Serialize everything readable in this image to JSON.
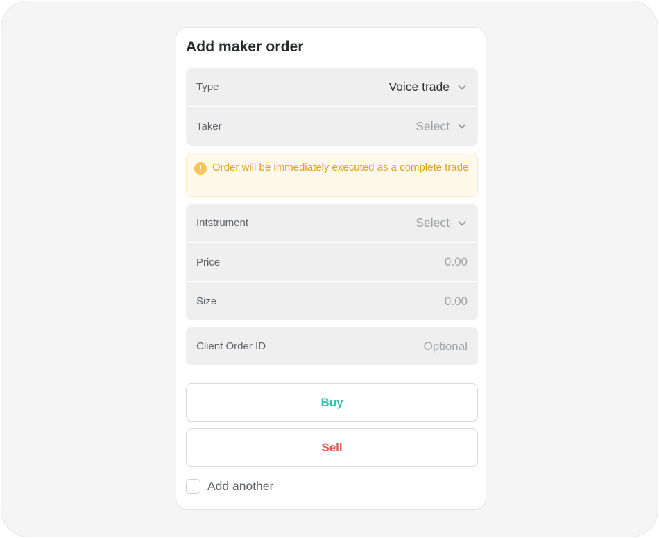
{
  "form": {
    "title": "Add maker order",
    "type": {
      "label": "Type",
      "value": "Voice trade"
    },
    "taker": {
      "label": "Taker",
      "value": "Select"
    },
    "notice": {
      "icon": "warning-circle-icon",
      "text": "Order will be immediately executed as a complete trade"
    },
    "instrument": {
      "label": "Intstrument",
      "value": "Select"
    },
    "price": {
      "label": "Price",
      "value": "0.00"
    },
    "size": {
      "label": "Size",
      "value": "0.00"
    },
    "client_order_id": {
      "label": "Client Order ID",
      "placeholder": "Optional"
    },
    "buy_label": "Buy",
    "sell_label": "Sell",
    "add_another_label": "Add another",
    "add_another_checked": false
  },
  "colors": {
    "buy": "#2bc4ae",
    "sell": "#e05a52",
    "notice_text": "#e3a019",
    "notice_bg": "#fff9ec"
  }
}
